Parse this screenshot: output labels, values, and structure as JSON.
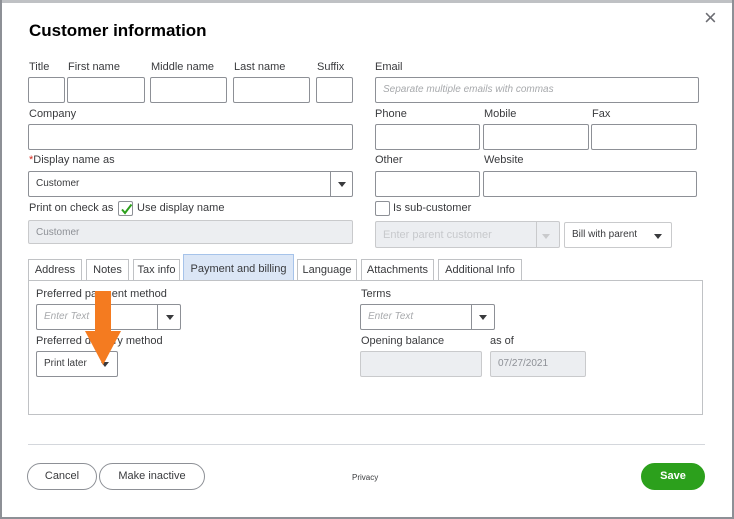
{
  "dialog": {
    "title": "Customer information",
    "close_glyph": "×"
  },
  "name": {
    "title_label": "Title",
    "first_label": "First name",
    "middle_label": "Middle name",
    "last_label": "Last name",
    "suffix_label": "Suffix"
  },
  "email": {
    "label": "Email",
    "placeholder": "Separate multiple emails with commas"
  },
  "company": {
    "label": "Company"
  },
  "phone": {
    "phone_label": "Phone",
    "mobile_label": "Mobile",
    "fax_label": "Fax"
  },
  "display_name": {
    "required_mark": "*",
    "label": "Display name as",
    "value": "Customer"
  },
  "other": {
    "other_label": "Other",
    "website_label": "Website"
  },
  "print_on_check": {
    "label": "Print on check as",
    "use_display_name_label": "Use display name",
    "use_display_name_checked": true,
    "value": "Customer"
  },
  "sub_customer": {
    "label": "Is sub-customer",
    "checked": false,
    "parent_placeholder": "Enter parent customer",
    "bill_with_parent": "Bill with parent"
  },
  "tabs": [
    {
      "label": "Address"
    },
    {
      "label": "Notes"
    },
    {
      "label": "Tax info"
    },
    {
      "label": "Payment and billing",
      "active": true
    },
    {
      "label": "Language"
    },
    {
      "label": "Attachments"
    },
    {
      "label": "Additional Info"
    }
  ],
  "payment": {
    "preferred_payment_label": "Preferred payment method",
    "preferred_payment_placeholder": "Enter Text",
    "terms_label": "Terms",
    "terms_placeholder": "Enter Text",
    "preferred_delivery_label": "Preferred delivery method",
    "preferred_delivery_value": "Print later",
    "opening_balance_label": "Opening balance",
    "as_of_label": "as of",
    "as_of_value": "07/27/2021"
  },
  "footer": {
    "cancel": "Cancel",
    "make_inactive": "Make inactive",
    "privacy": "Privacy",
    "save": "Save"
  },
  "colors": {
    "annotation_arrow": "#f47b20",
    "save_green": "#2ca01c",
    "active_tab": "#dbe6f6"
  },
  "icons": [
    "close-icon",
    "chevron-down-icon",
    "checkmark-icon",
    "annotation-arrow-icon"
  ]
}
